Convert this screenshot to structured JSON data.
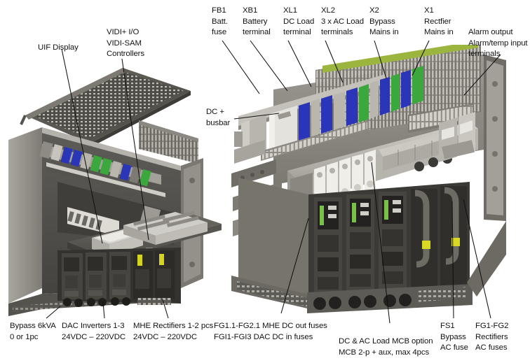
{
  "figure": {
    "title": "Power system cabinet component identification diagram",
    "background_color": "#ffffff",
    "text_color": "#131313"
  },
  "callouts": {
    "uif_display": "UIF Display",
    "vidi_controllers": "VIDI+ I/O\nVIDI-SAM\nControllers",
    "fb1": "FB1\nBatt.\nfuse",
    "xb1": "XB1\nBattery\nterminal",
    "xl1": "XL1\nDC Load\nterminal",
    "xl2": "XL2\n3 x AC Load\nterminals",
    "x2": "X2\nBypass\nMains in",
    "x1": "X1\nRectfier\nMains in",
    "alarm": "Alarm output\nAlarm/temp input\nterminals",
    "dc_busbar": "DC +\nbusbar",
    "bypass": "Bypass 6kVA\n0 or 1pc",
    "dac_inverters": "DAC Inverters 1-3\n24VDC – 220VDC",
    "mhe_rectifiers": "MHE Rectifiers 1-2 pcs\n24VDC – 220VDC",
    "dc_fuses": "FG1.1-FG2.1 MHE DC out fuses\nFGI1-FGI3 DAC DC in fuses",
    "mcb_option": "DC & AC Load MCB option\nMCB 2-p + aux, max 4pcs",
    "fs1": "FS1\nBypass\nAC fuse",
    "fg1_fg2": "FG1-FG2\nRectifiers\nAC fuses"
  },
  "colors": {
    "cabinet_dark": "#4c4a46",
    "cabinet_mid": "#6e6b64",
    "cabinet_light": "#9a978f",
    "panel_grey": "#85827b",
    "metal_light": "#c9c7c1",
    "metal_bright": "#e0ded8",
    "terminal_blue": "#2b35b8",
    "terminal_green": "#3aa83c",
    "terminal_grey": "#b9b6ae",
    "terminal_white": "#eceae4",
    "accent_yellow": "#d9d923",
    "module_face": "#3a3935",
    "module_dark": "#2a2926",
    "led_green": "#79c24a",
    "leader_line": "#111111"
  }
}
